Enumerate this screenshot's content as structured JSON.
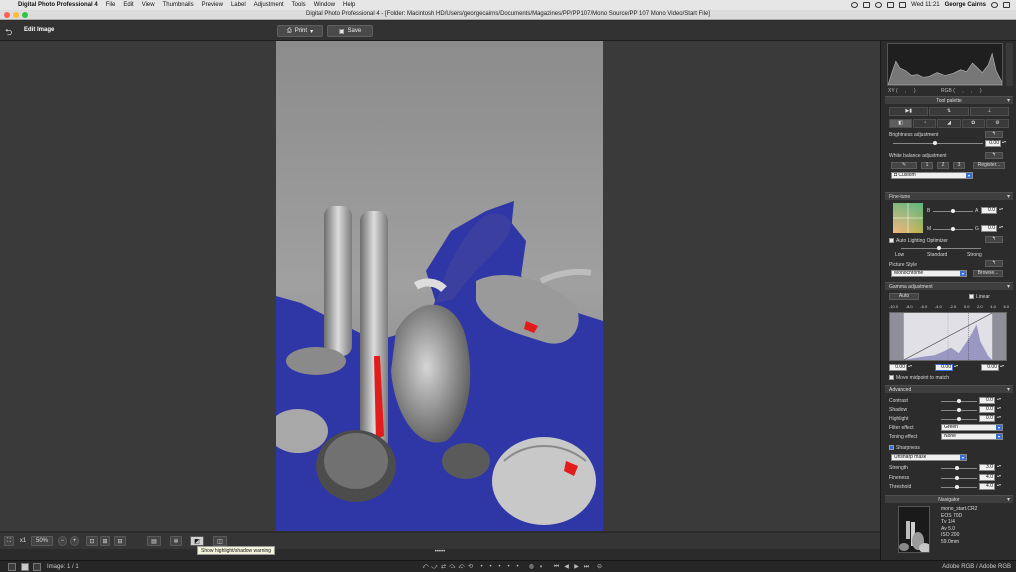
{
  "menubar": {
    "app_name": "Digital Photo Professional 4",
    "items": [
      "File",
      "Edit",
      "View",
      "Thumbnails",
      "Preview",
      "Label",
      "Adjustment",
      "Tools",
      "Window",
      "Help"
    ],
    "clock": "Wed 11:21",
    "user": "George Cairns"
  },
  "window": {
    "title": "Digital Photo Professional 4 - [Folder: Macintosh HD/Users/georgecairns/Documents/Magazines/PP/PP107/Mono Source/PP 107 Mono Video/Start File]"
  },
  "toolbar": {
    "mode_label": "Edit Image",
    "print_label": "Print",
    "save_label": "Save"
  },
  "bottom": {
    "zoom_x1": "x1",
    "zoom_value": "50%",
    "tooltip": "Show highlight/shadow warning"
  },
  "status": {
    "image_count": "Image: 1 / 1",
    "colorspace": "Adobe RGB / Adobe RGB"
  },
  "panel": {
    "histogram_readout": {
      "xy": "XY (",
      "xy_sep": ",",
      "xy_end": ")",
      "rgb": "RGB (",
      "rgb_sep1": ",",
      "rgb_sep2": ",",
      "rgb_end": ")"
    },
    "tool_palette_label": "Tool palette",
    "brightness": {
      "label": "Brightness adjustment",
      "value": "0.00"
    },
    "white_balance": {
      "label": "White balance adjustment",
      "slots": [
        "1",
        "2",
        "3"
      ],
      "register": "Register...",
      "preset": "Custom"
    },
    "fine_tune": {
      "label": "Fine-tune",
      "b_label": "B",
      "a_label": "A",
      "a_value": "0.0",
      "m_label": "M",
      "g_label": "G",
      "g_value": "0.0"
    },
    "alo": {
      "label": "Auto Lighting Optimizer",
      "low": "Low",
      "standard": "Standard",
      "strong": "Strong"
    },
    "picture_style": {
      "label": "Picture Style",
      "value": "Monochrome",
      "browse": "Browse..."
    },
    "gamma": {
      "label": "Gamma adjustment",
      "auto": "Auto",
      "linear": "Linear",
      "scale": [
        "-10.0",
        "-8.0",
        "-6.0",
        "-4.0",
        "-2.0",
        "0.0",
        "2.0",
        "4.0",
        "6.0"
      ],
      "in_values": [
        "0.00",
        "0.00",
        "0.00"
      ],
      "move_midpoint": "Move midpoint to match"
    },
    "advanced": {
      "label": "Advanced",
      "contrast": {
        "label": "Contrast",
        "value": "0.0"
      },
      "shadow": {
        "label": "Shadow",
        "value": "0.0"
      },
      "highlight": {
        "label": "Highlight",
        "value": "0.0"
      },
      "filter_effect": {
        "label": "Filter effect",
        "value": "Green"
      },
      "toning_effect": {
        "label": "Toning effect",
        "value": "None"
      },
      "sharpness": {
        "label": "Sharpness",
        "mode": "Unsharp mask"
      },
      "strength": {
        "label": "Strength",
        "value": "3.0"
      },
      "fineness": {
        "label": "Fineness",
        "value": "4.0"
      },
      "threshold": {
        "label": "Threshold",
        "value": "4.0"
      }
    },
    "navigator": {
      "label": "Navigator",
      "file": "mono_start.CR2",
      "camera": "EOS 70D",
      "tv": "Tv 1/4",
      "av": "Av 5.0",
      "iso": "ISO 200",
      "focal": "59.0mm"
    }
  },
  "colors": {
    "shadow_warning": "#2f36a6",
    "highlight_warning": "#e21b1b",
    "accent": "#3a6fd8"
  }
}
